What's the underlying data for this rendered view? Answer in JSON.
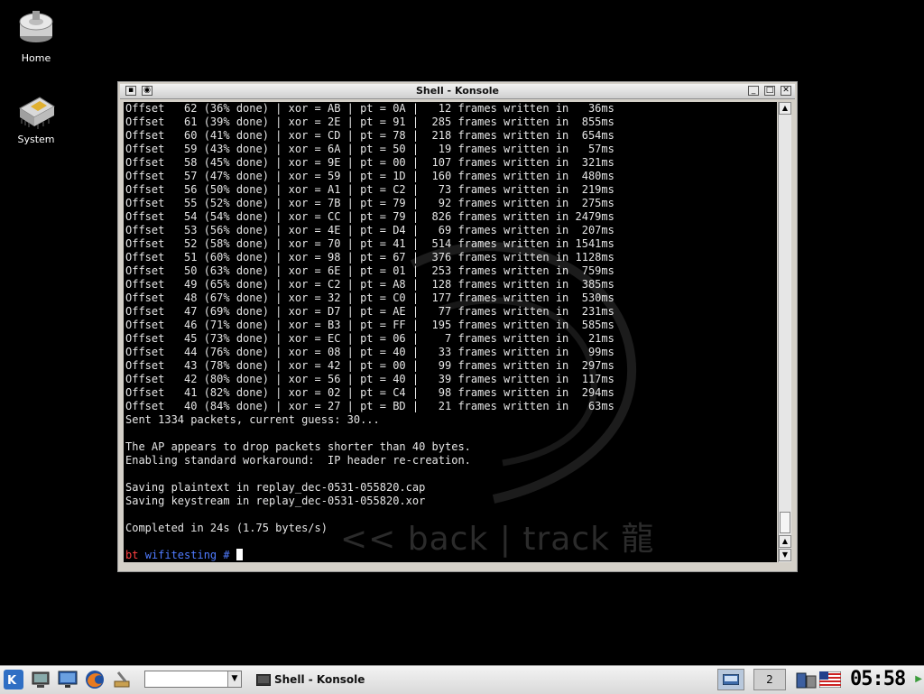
{
  "desktop": {
    "icons": [
      {
        "label": "Home",
        "icon": "hard-drive-icon"
      },
      {
        "label": "System",
        "icon": "chip-icon"
      }
    ]
  },
  "window": {
    "title": "Shell - Konsole",
    "buttons": [
      "minimize",
      "maximize",
      "close"
    ]
  },
  "terminal": {
    "lines": [
      "Offset   62 (36% done) | xor = AB | pt = 0A |   12 frames written in   36ms",
      "Offset   61 (39% done) | xor = 2E | pt = 91 |  285 frames written in  855ms",
      "Offset   60 (41% done) | xor = CD | pt = 78 |  218 frames written in  654ms",
      "Offset   59 (43% done) | xor = 6A | pt = 50 |   19 frames written in   57ms",
      "Offset   58 (45% done) | xor = 9E | pt = 00 |  107 frames written in  321ms",
      "Offset   57 (47% done) | xor = 59 | pt = 1D |  160 frames written in  480ms",
      "Offset   56 (50% done) | xor = A1 | pt = C2 |   73 frames written in  219ms",
      "Offset   55 (52% done) | xor = 7B | pt = 79 |   92 frames written in  275ms",
      "Offset   54 (54% done) | xor = CC | pt = 79 |  826 frames written in 2479ms",
      "Offset   53 (56% done) | xor = 4E | pt = D4 |   69 frames written in  207ms",
      "Offset   52 (58% done) | xor = 70 | pt = 41 |  514 frames written in 1541ms",
      "Offset   51 (60% done) | xor = 98 | pt = 67 |  376 frames written in 1128ms",
      "Offset   50 (63% done) | xor = 6E | pt = 01 |  253 frames written in  759ms",
      "Offset   49 (65% done) | xor = C2 | pt = A8 |  128 frames written in  385ms",
      "Offset   48 (67% done) | xor = 32 | pt = C0 |  177 frames written in  530ms",
      "Offset   47 (69% done) | xor = D7 | pt = AE |   77 frames written in  231ms",
      "Offset   46 (71% done) | xor = B3 | pt = FF |  195 frames written in  585ms",
      "Offset   45 (73% done) | xor = EC | pt = 06 |    7 frames written in   21ms",
      "Offset   44 (76% done) | xor = 08 | pt = 40 |   33 frames written in   99ms",
      "Offset   43 (78% done) | xor = 42 | pt = 00 |   99 frames written in  297ms",
      "Offset   42 (80% done) | xor = 56 | pt = 40 |   39 frames written in  117ms",
      "Offset   41 (82% done) | xor = 02 | pt = C4 |   98 frames written in  294ms",
      "Offset   40 (84% done) | xor = 27 | pt = BD |   21 frames written in   63ms",
      "Sent 1334 packets, current guess: 30...",
      "",
      "The AP appears to drop packets shorter than 40 bytes.",
      "Enabling standard workaround:  IP header re-creation.",
      "",
      "Saving plaintext in replay_dec-0531-055820.cap",
      "Saving keystream in replay_dec-0531-055820.xor",
      "",
      "Completed in 24s (1.75 bytes/s)",
      ""
    ],
    "prompt_host": "bt",
    "prompt_dir": "wifitesting #",
    "watermark": "<< back | track 龍"
  },
  "taskbar": {
    "launchers": [
      "kde-menu-icon",
      "desktop-icon",
      "monitor-icon",
      "firefox-icon",
      "tools-icon"
    ],
    "combo_value": "",
    "task_label": "Shell - Konsole",
    "pager_desktop": "2",
    "clock": "05:58"
  },
  "colors": {
    "prompt_host": "#ff4040",
    "prompt_dir": "#4f7bff",
    "terminal_text": "#e6e6e6"
  }
}
